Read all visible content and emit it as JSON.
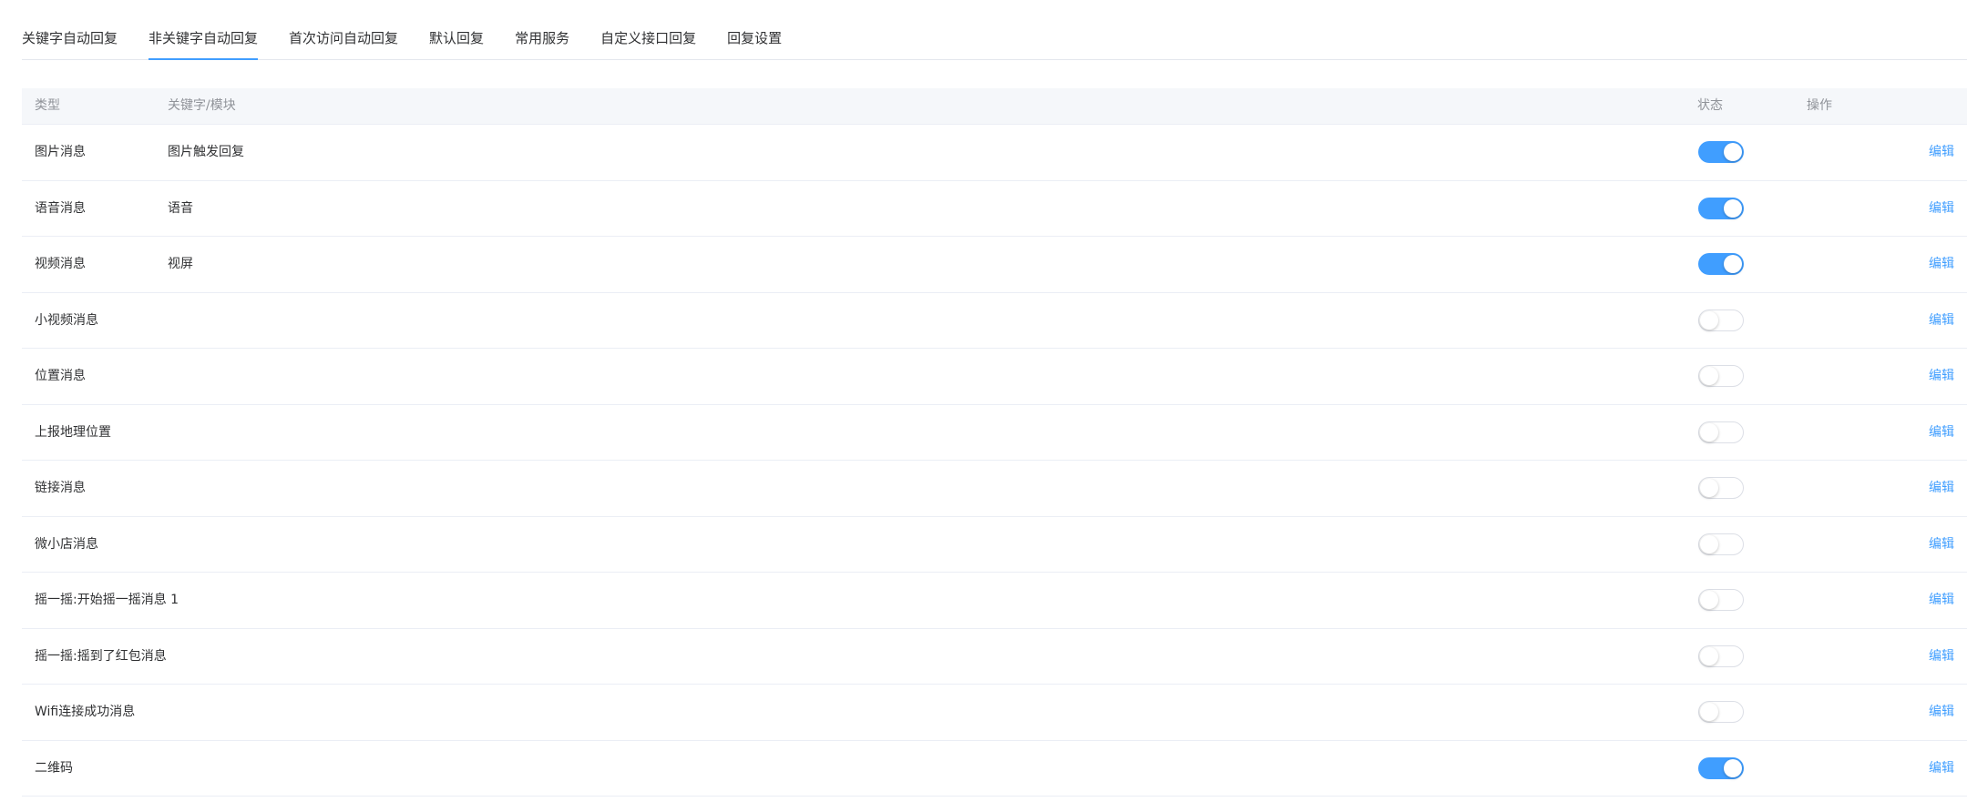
{
  "tabs": [
    {
      "label": "关键字自动回复"
    },
    {
      "label": "非关键字自动回复",
      "active": true
    },
    {
      "label": "首次访问自动回复"
    },
    {
      "label": "默认回复"
    },
    {
      "label": "常用服务"
    },
    {
      "label": "自定义接口回复"
    },
    {
      "label": "回复设置"
    }
  ],
  "table": {
    "headers": {
      "type": "类型",
      "keyword": "关键字/模块",
      "status": "状态",
      "action": "操作"
    },
    "rows": [
      {
        "type": "图片消息",
        "keyword": "图片触发回复",
        "enabled": true,
        "action": "编辑"
      },
      {
        "type": "语音消息",
        "keyword": "语音",
        "enabled": true,
        "action": "编辑"
      },
      {
        "type": "视频消息",
        "keyword": "视屏",
        "enabled": true,
        "action": "编辑"
      },
      {
        "type": "小视频消息",
        "keyword": "",
        "enabled": false,
        "action": "编辑"
      },
      {
        "type": "位置消息",
        "keyword": "",
        "enabled": false,
        "action": "编辑"
      },
      {
        "type": "上报地理位置",
        "keyword": "",
        "enabled": false,
        "action": "编辑"
      },
      {
        "type": "链接消息",
        "keyword": "",
        "enabled": false,
        "action": "编辑"
      },
      {
        "type": "微小店消息",
        "keyword": "",
        "enabled": false,
        "action": "编辑"
      },
      {
        "type": "摇一摇:开始摇一摇消息 1",
        "keyword": "",
        "enabled": false,
        "action": "编辑"
      },
      {
        "type": "摇一摇:摇到了红包消息",
        "keyword": "",
        "enabled": false,
        "action": "编辑"
      },
      {
        "type": "Wifi连接成功消息",
        "keyword": "",
        "enabled": false,
        "action": "编辑"
      },
      {
        "type": "二维码",
        "keyword": "",
        "enabled": true,
        "action": "编辑"
      }
    ]
  },
  "colors": {
    "accent": "#409eff",
    "header_bg": "#f5f7fa",
    "border": "#ebeef5"
  }
}
